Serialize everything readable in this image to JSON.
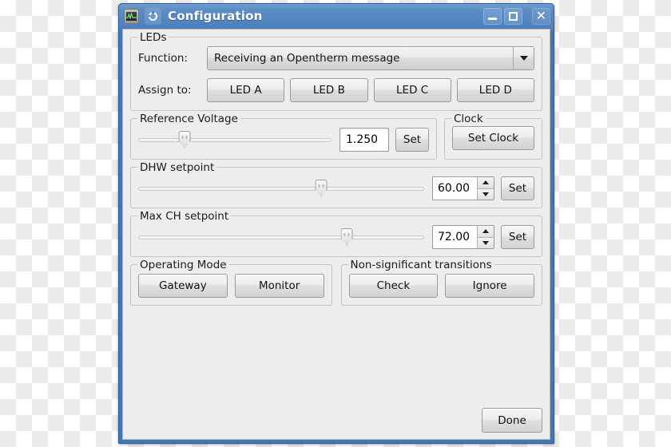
{
  "window": {
    "title": "Configuration",
    "app_icon": "waveform-monitor-icon",
    "menu_icon": "window-menu-icon",
    "minimize_label": "Minimize",
    "maximize_label": "Maximize",
    "close_label": "Close"
  },
  "leds": {
    "legend": "LEDs",
    "function_label": "Function:",
    "function_value": "Receiving an Opentherm message",
    "assign_label": "Assign to:",
    "buttons": [
      "LED A",
      "LED B",
      "LED C",
      "LED D"
    ]
  },
  "reference_voltage": {
    "legend": "Reference Voltage",
    "value": "1.250",
    "set_label": "Set",
    "slider_percent": 24
  },
  "clock": {
    "legend": "Clock",
    "set_clock_label": "Set Clock"
  },
  "dhw_setpoint": {
    "legend": "DHW setpoint",
    "value": "60.00",
    "set_label": "Set",
    "slider_percent": 64
  },
  "max_ch_setpoint": {
    "legend": "Max CH setpoint",
    "value": "72.00",
    "set_label": "Set",
    "slider_percent": 73
  },
  "operating_mode": {
    "legend": "Operating Mode",
    "buttons": [
      "Gateway",
      "Monitor"
    ]
  },
  "non_significant_transitions": {
    "legend": "Non-significant transitions",
    "buttons": [
      "Check",
      "Ignore"
    ]
  },
  "footer": {
    "done_label": "Done"
  }
}
